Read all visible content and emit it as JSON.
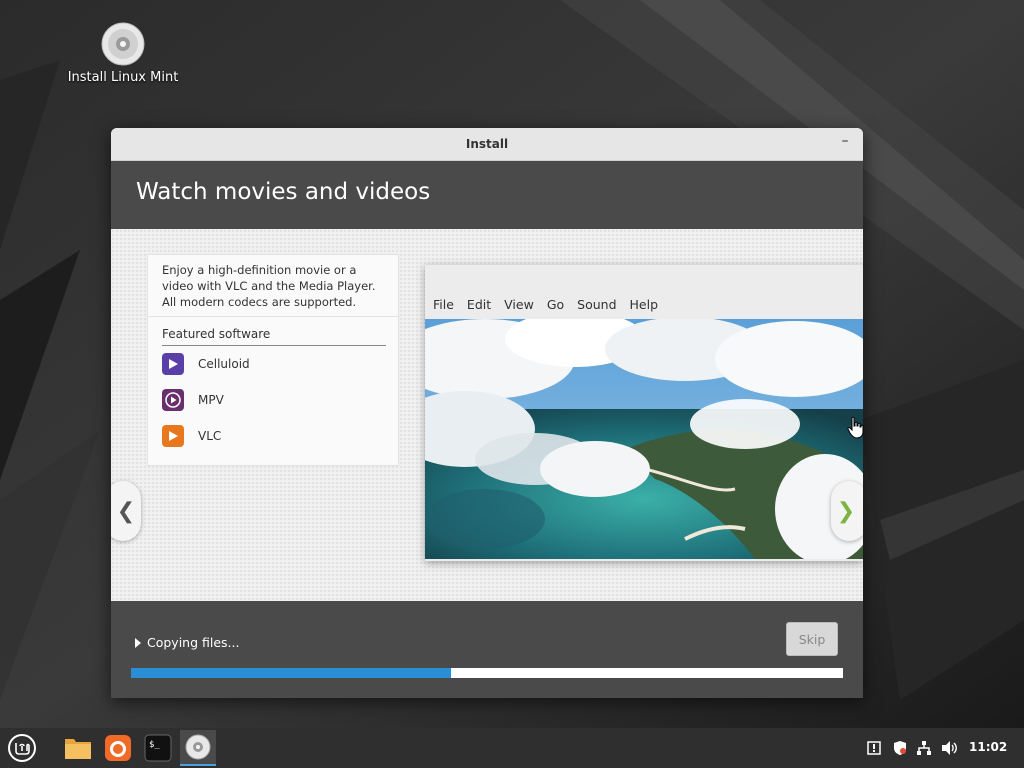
{
  "desktop": {
    "icon_label": "Install Linux Mint"
  },
  "window": {
    "title": "Install",
    "minimize": "–",
    "header_title": "Watch movies and videos"
  },
  "slide": {
    "description": "Enjoy a high-definition movie or a video with VLC and the Media Player. All modern codecs are supported.",
    "featured_label": "Featured software",
    "apps": [
      {
        "name": "Celluloid",
        "icon": "celluloid-icon",
        "color": "#5b3fa8"
      },
      {
        "name": "MPV",
        "icon": "mpv-icon",
        "color": "#6a2d6e"
      },
      {
        "name": "VLC",
        "icon": "vlc-icon",
        "color": "#e8771e"
      }
    ],
    "player_menu": [
      "File",
      "Edit",
      "View",
      "Go",
      "Sound",
      "Help"
    ],
    "prev_glyph": "❮",
    "next_glyph": "❯"
  },
  "footer": {
    "status": "Copying files...",
    "skip_label": "Skip",
    "progress": 0.45,
    "progress_color": "#2a8ed6"
  },
  "taskbar": {
    "clock": "11:02",
    "apps": [
      "mint-menu-icon",
      "files-icon",
      "firefox-icon",
      "terminal-icon",
      "installer-disc-icon"
    ],
    "tray": [
      "notification-icon",
      "shield-icon",
      "network-icon",
      "volume-icon"
    ]
  }
}
